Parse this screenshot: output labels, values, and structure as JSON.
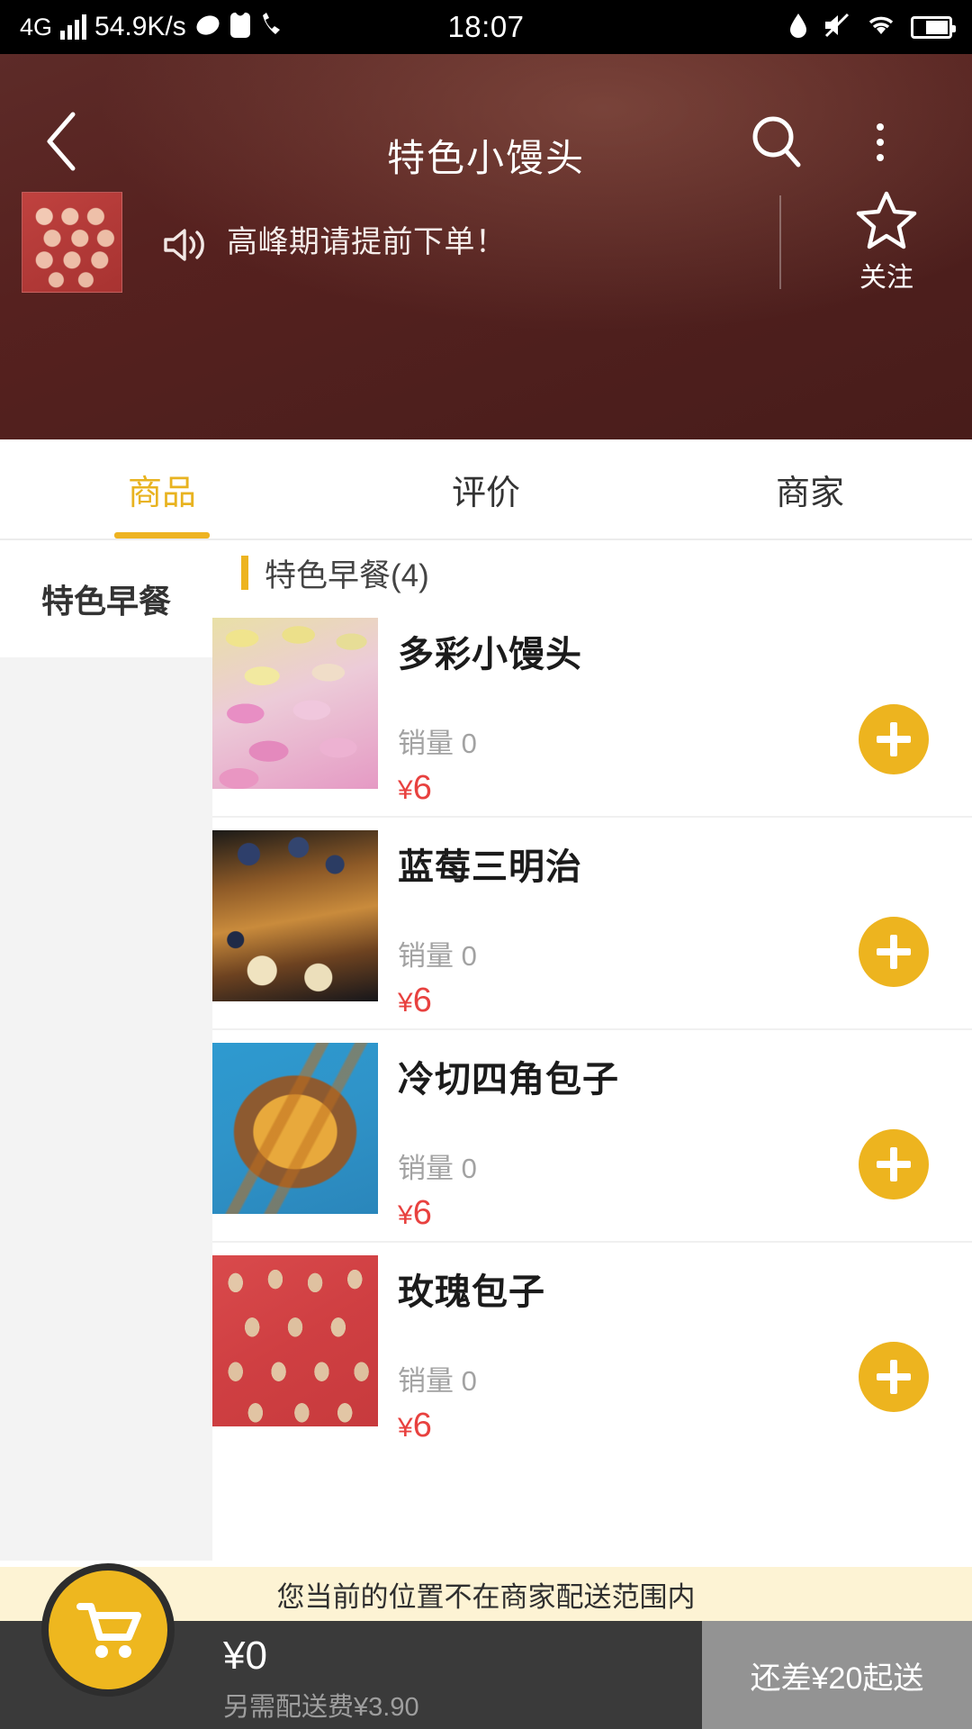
{
  "status_bar": {
    "network_type": "4G",
    "speed": "54.9K/s",
    "time": "18:07",
    "icons_left": [
      "signal-bars-icon",
      "ellipse-icon",
      "sim-card-icon",
      "phone-call-icon"
    ],
    "icons_right": [
      "water-drop-icon",
      "mute-icon",
      "wifi-icon",
      "battery-icon"
    ]
  },
  "header": {
    "title": "特色小馒头",
    "back_icon": "chevron-left-icon",
    "search_icon": "search-icon",
    "more_icon": "more-vertical-icon",
    "background_color": "#50201e"
  },
  "announcement": {
    "speaker_icon": "speaker-icon",
    "text": "高峰期请提前下单！",
    "shop_logo_alt": "shop-logo"
  },
  "favorite": {
    "icon": "star-outline-icon",
    "label": "关注"
  },
  "tabs": [
    {
      "label": "商品",
      "active": true
    },
    {
      "label": "评价",
      "active": false
    },
    {
      "label": "商家",
      "active": false
    }
  ],
  "tab_accent_color": "#eeb321",
  "categories": [
    {
      "label": "特色早餐",
      "active": true
    }
  ],
  "section": {
    "title": "特色早餐(4)",
    "bar_color": "#edb420"
  },
  "products": [
    {
      "name": "多彩小馒头",
      "sales_label": "销量",
      "sales_count": "0",
      "currency": "¥",
      "price": "6",
      "add_icon": "plus-icon",
      "image": "macaron-photo"
    },
    {
      "name": "蓝莓三明治",
      "sales_label": "销量",
      "sales_count": "0",
      "currency": "¥",
      "price": "6",
      "add_icon": "plus-icon",
      "image": "blueberry-sandwich-photo"
    },
    {
      "name": "冷切四角包子",
      "sales_label": "销量",
      "sales_count": "0",
      "currency": "¥",
      "price": "6",
      "add_icon": "plus-icon",
      "image": "toast-sandwich-photo"
    },
    {
      "name": "玫瑰包子",
      "sales_label": "销量",
      "sales_count": "0",
      "currency": "¥",
      "price": "6",
      "add_icon": "plus-icon",
      "image": "rose-buns-photo"
    }
  ],
  "warning": {
    "text": "您当前的位置不在商家配送范围内",
    "background_color": "#fdf3d4"
  },
  "cart": {
    "icon": "shopping-cart-icon",
    "total": "¥0",
    "delivery_fee_note": "另需配送费¥3.90",
    "checkout_label": "还差¥20起送",
    "checkout_enabled": false,
    "accent_color": "#eeb71f"
  }
}
